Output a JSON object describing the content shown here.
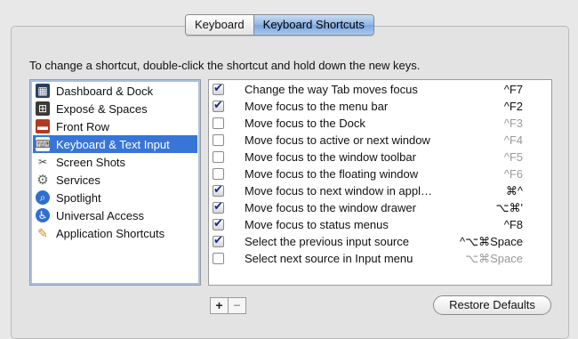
{
  "tabs": [
    {
      "label": "Keyboard",
      "active": false
    },
    {
      "label": "Keyboard Shortcuts",
      "active": true
    }
  ],
  "instruction": "To change a shortcut, double-click the shortcut and hold down the new keys.",
  "categories": [
    {
      "label": "Dashboard & Dock",
      "icon": "dashboard-dock-icon",
      "selected": false
    },
    {
      "label": "Exposé & Spaces",
      "icon": "expose-spaces-icon",
      "selected": false
    },
    {
      "label": "Front Row",
      "icon": "front-row-icon",
      "selected": false
    },
    {
      "label": "Keyboard & Text Input",
      "icon": "keyboard-text-input-icon",
      "selected": true
    },
    {
      "label": "Screen Shots",
      "icon": "screen-shots-icon",
      "selected": false
    },
    {
      "label": "Services",
      "icon": "services-gear-icon",
      "selected": false
    },
    {
      "label": "Spotlight",
      "icon": "spotlight-icon",
      "selected": false
    },
    {
      "label": "Universal Access",
      "icon": "universal-access-icon",
      "selected": false
    },
    {
      "label": "Application Shortcuts",
      "icon": "application-shortcuts-icon",
      "selected": false
    }
  ],
  "shortcuts": [
    {
      "label": "Change the way Tab moves focus",
      "key": "^F7",
      "checked": true
    },
    {
      "label": "Move focus to the menu bar",
      "key": "^F2",
      "checked": true
    },
    {
      "label": "Move focus to the Dock",
      "key": "^F3",
      "checked": false
    },
    {
      "label": "Move focus to active or next window",
      "key": "^F4",
      "checked": false
    },
    {
      "label": "Move focus to the window toolbar",
      "key": "^F5",
      "checked": false
    },
    {
      "label": "Move focus to the floating window",
      "key": "^F6",
      "checked": false
    },
    {
      "label": "Move focus to next window in appl…",
      "key": "⌘^",
      "checked": true
    },
    {
      "label": "Move focus to the window drawer",
      "key": "⌥⌘'",
      "checked": true
    },
    {
      "label": "Move focus to status menus",
      "key": "^F8",
      "checked": true
    },
    {
      "label": "Select the previous input source",
      "key": "^⌥⌘Space",
      "checked": true
    },
    {
      "label": "Select next source in Input menu",
      "key": "⌥⌘Space",
      "checked": false
    }
  ],
  "buttons": {
    "add": "+",
    "remove": "−",
    "restore_defaults": "Restore Defaults"
  }
}
